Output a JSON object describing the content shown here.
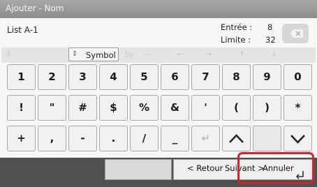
{
  "window": {
    "title": "Ajouter - Nom"
  },
  "header": {
    "list_name": "List A-1",
    "entry_label": "Entrée :",
    "entry_value": "8",
    "limit_label": "Limite :",
    "limit_value": "32"
  },
  "modebar": {
    "symbol_label": "Symbol",
    "ghost_letter": "Sy",
    "ghost_dash": "—",
    "ghost_left": "←",
    "ghost_right": "→",
    "ghost_up": "↑",
    "ghost_down": "↓"
  },
  "keyboard": {
    "row1": [
      "1",
      "2",
      "3",
      "4",
      "5",
      "6",
      "7",
      "8",
      "9",
      "0"
    ],
    "row2": [
      "!",
      "\"",
      "#",
      "$",
      "%",
      "&",
      "'",
      "(",
      ")",
      "*"
    ],
    "row3": [
      "+",
      ",",
      "-",
      ".",
      "/",
      "_",
      "↵",
      "︿",
      "",
      ""
    ]
  },
  "bottom": {
    "back_label": "< Retour",
    "next_label": "Suivant >",
    "cancel_label": "Annuler"
  },
  "colors": {
    "highlight": "#d6202b",
    "titlebar": "#9a9a9a",
    "bottombar": "#505050"
  }
}
